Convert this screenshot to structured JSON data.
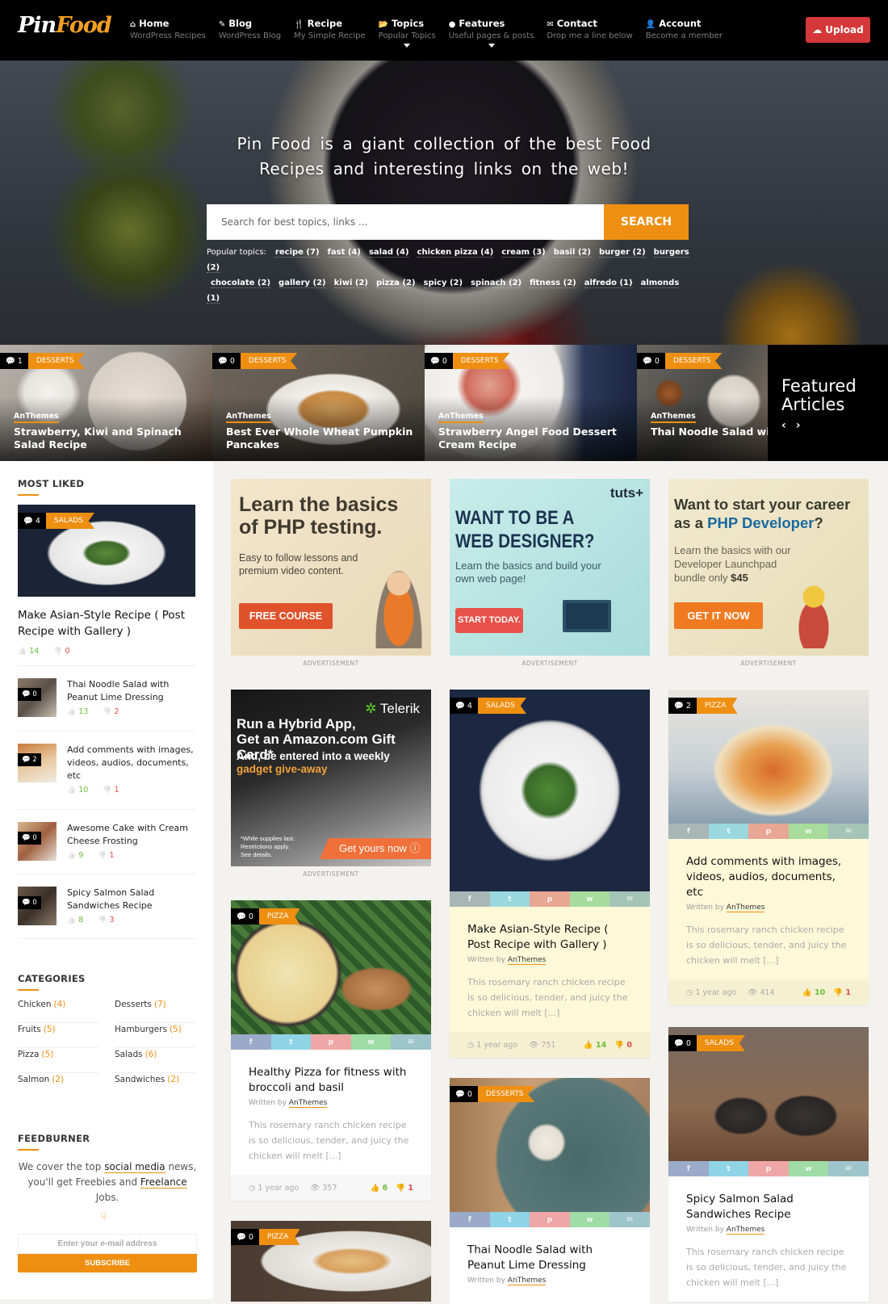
{
  "header": {
    "logo": {
      "pin": "Pin",
      "food": "Food"
    },
    "nav": [
      {
        "icon": "home-icon",
        "glyph": "⌂",
        "label": "Home",
        "sub": "WordPress Recipes",
        "dropdown": false
      },
      {
        "icon": "edit-icon",
        "glyph": "✎",
        "label": "Blog",
        "sub": "WordPress Blog",
        "dropdown": false
      },
      {
        "icon": "cutlery-icon",
        "glyph": "🍴",
        "label": "Recipe",
        "sub": "My Simple Recipe",
        "dropdown": false
      },
      {
        "icon": "folder-icon",
        "glyph": "📂",
        "label": "Topics",
        "sub": "Popular Topics",
        "dropdown": true
      },
      {
        "icon": "bomb-icon",
        "glyph": "●",
        "label": "Features",
        "sub": "Useful pages & posts",
        "dropdown": true
      },
      {
        "icon": "envelope-icon",
        "glyph": "✉",
        "label": "Contact",
        "sub": "Drop me a line below",
        "dropdown": false
      },
      {
        "icon": "user-plus-icon",
        "glyph": "👤",
        "label": "Account",
        "sub": "Become a member",
        "dropdown": false
      }
    ],
    "upload_label": "Upload",
    "upload_icon": "☁"
  },
  "hero": {
    "title": "Pin Food is a giant collection of the best Food Recipes and interesting links on the web!",
    "search_placeholder": "Search for best topics, links ...",
    "search_button": "SEARCH",
    "popular_label": "Popular topics:",
    "topics": [
      "recipe (7)",
      "fast (4)",
      "salad (4)",
      "chicken pizza (4)",
      "cream (3)",
      "basil (2)",
      "burger (2)",
      "burgers (2)",
      "chocolate (2)",
      "gallery (2)",
      "kiwi (2)",
      "pizza (2)",
      "spicy (2)",
      "spinach (2)",
      "fitness (2)",
      "alfredo (1)",
      "almonds (1)"
    ]
  },
  "featured": {
    "label_line1": "Featured",
    "label_line2": "Articles",
    "prev": "‹",
    "next": "›",
    "items": [
      {
        "comments": "1",
        "category": "DESSERTS",
        "author": "AnThemes",
        "title": "Strawberry, Kiwi and Spinach Salad Recipe"
      },
      {
        "comments": "0",
        "category": "DESSERTS",
        "author": "AnThemes",
        "title": "Best Ever Whole Wheat Pumpkin Pancakes"
      },
      {
        "comments": "0",
        "category": "DESSERTS",
        "author": "AnThemes",
        "title": "Strawberry Angel Food Dessert Cream Recipe"
      },
      {
        "comments": "0",
        "category": "DESSERTS",
        "author": "AnThemes",
        "title": "Thai Noodle Salad with Peanut Lime Dressing"
      }
    ]
  },
  "sidebar": {
    "most_liked_title": "MOST LIKED",
    "top": {
      "comments": "4",
      "category": "SALADS",
      "title": "Make Asian-Style Recipe ( Post Recipe with Gallery )",
      "likes": "14",
      "dislikes": "0"
    },
    "list": [
      {
        "comments": "0",
        "title": "Thai Noodle Salad with Peanut Lime Dressing",
        "likes": "13",
        "dislikes": "2"
      },
      {
        "comments": "2",
        "title": "Add comments with images, videos, audios, documents, etc",
        "likes": "10",
        "dislikes": "1"
      },
      {
        "comments": "0",
        "title": "Awesome Cake with Cream Cheese Frosting",
        "likes": "9",
        "dislikes": "1"
      },
      {
        "comments": "0",
        "title": "Spicy Salmon Salad Sandwiches Recipe",
        "likes": "8",
        "dislikes": "3"
      }
    ],
    "categories_title": "CATEGORIES",
    "categories": [
      {
        "name": "Chicken",
        "count": "(4)"
      },
      {
        "name": "Desserts",
        "count": "(7)"
      },
      {
        "name": "Fruits",
        "count": "(5)"
      },
      {
        "name": "Hamburgers",
        "count": "(5)"
      },
      {
        "name": "Pizza",
        "count": "(5)"
      },
      {
        "name": "Salads",
        "count": "(6)"
      },
      {
        "name": "Salmon",
        "count": "(2)"
      },
      {
        "name": "Sandwiches",
        "count": "(2)"
      }
    ],
    "feedburner_title": "FEEDBURNER",
    "feedburner": {
      "t1": "We cover the top ",
      "link1": "social media",
      "t2": " news, you'll get Freebies and ",
      "link2": "Freelance",
      "t3": " Jobs.",
      "email_placeholder": "Enter your e-mail address",
      "subscribe": "SUBSCRIBE"
    }
  },
  "ads": {
    "caption": "ADVERTISEMENT",
    "ad1": {
      "h1": "Learn the basics",
      "h2": "of PHP testing.",
      "p1": "Easy to follow lessons and",
      "p2": "premium video content.",
      "button": "FREE COURSE"
    },
    "ad2": {
      "logo": "tuts+",
      "h1": "WANT TO BE A",
      "h2": "WEB DESIGNER?",
      "p": "Learn the basics and build your own web page!",
      "button": "START TODAY."
    },
    "ad3": {
      "h1": "Want to start your career",
      "h2a": "as a ",
      "h2b": "PHP Developer",
      "h2c": "?",
      "p1": "Learn the basics with our",
      "p2": "Developer Launchpad",
      "p3a": "bundle only ",
      "p3b": "$45",
      "button": "GET IT NOW"
    },
    "ad4": {
      "logo": "Telerik",
      "h1": "Run a Hybrid App,",
      "h2": "Get an Amazon.com Gift Card*",
      "p1": "And, be entered into a weekly",
      "p2": "gadget give-away",
      "fine1": "*While supplies last.",
      "fine2": "Restrictions apply.",
      "fine3": "See details.",
      "button": "Get yours now"
    }
  },
  "posts": {
    "written_by": "Written by",
    "author": "AnThemes",
    "excerpt": "This rosemary ranch chicken recipe is so delicious, tender, and juicy the chicken will melt [...]",
    "share": [
      "f",
      "t",
      "p",
      "w",
      "✉"
    ],
    "items": [
      {
        "comments": "4",
        "category": "SALADS",
        "title": "Make Asian-Style Recipe ( Post Recipe with Gallery )",
        "time": "1 year ago",
        "views": "751",
        "likes": "14",
        "dislikes": "0"
      },
      {
        "comments": "2",
        "category": "PIZZA",
        "title": "Add comments with images, videos, audios, documents, etc",
        "time": "1 year ago",
        "views": "414",
        "likes": "10",
        "dislikes": "1"
      },
      {
        "comments": "0",
        "category": "PIZZA",
        "title": "Healthy Pizza for fitness with broccoli and basil",
        "time": "1 year ago",
        "views": "357",
        "likes": "6",
        "dislikes": "1"
      },
      {
        "comments": "0",
        "category": "DESSERTS",
        "title": "Thai Noodle Salad with Peanut Lime Dressing"
      },
      {
        "comments": "0",
        "category": "SALADS",
        "title": "Spicy Salmon Salad Sandwiches Recipe"
      },
      {
        "comments": "0",
        "category": "PIZZA"
      }
    ]
  },
  "colors": {
    "accent": "#ee8f12",
    "upload": "#d43838",
    "like": "#6cbf3a",
    "dislike": "#e24b4b"
  }
}
